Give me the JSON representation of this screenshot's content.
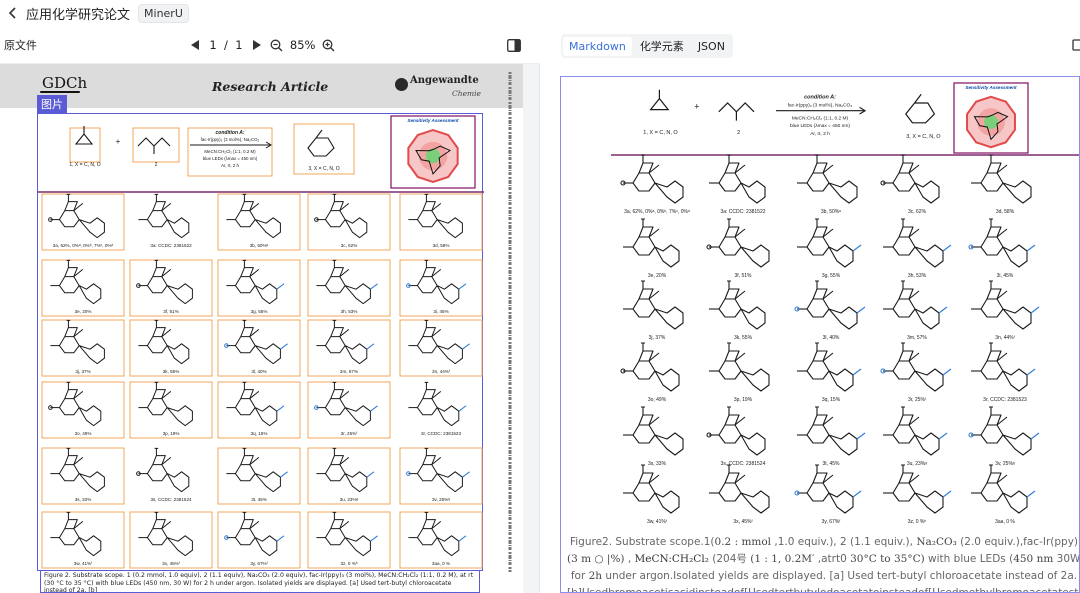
{
  "header": {
    "title": "应用化学研究论文",
    "badge": "MinerU"
  },
  "left_pane": {
    "label": "原文件",
    "current_page": "1",
    "page_separator": "/",
    "total_pages": "1",
    "zoom": "85%",
    "figure_tag": "图片",
    "page": {
      "publisher_logo": "GDCh",
      "article_type": "Research Article",
      "journal_name": "Angewandte",
      "journal_subtitle": "Chemie"
    },
    "caption_line1": "Figure 2. Substrate scope. 1 (0.2 mmol, 1.0 equiv), 2 (1.1 equiv), Na₂CO₃ (2.0 equiv), fac-Ir(ppy)₃ (3 mol%), MeCN:CH₂Cl₂ (1:1, 0.2 M), at rt",
    "caption_line2": "(30 °C to 35 °C) with blue LEDs (450 nm, 30 W) for 2 h under argon. Isolated yields are displayed. [a] Used tert-butyl chloroacetate instead of 2a. [b]"
  },
  "right_pane": {
    "tabs": [
      {
        "label": "Markdown",
        "active": true
      },
      {
        "label": "化学元素",
        "active": false
      },
      {
        "label": "JSON",
        "active": false
      }
    ],
    "caption_line1_a": "Figure2. Substrate scope.1(",
    "caption_line1_m1": "0.2  : mmol",
    "caption_line1_b": " ,1.0 equiv.), 2 (1.1 equiv.), ",
    "caption_line1_m2": "Na₂CO₃",
    "caption_line1_c": " (2.0 equiv.),fac-Ir(ppy)",
    "caption_line2_m1": "(3 m ○ |%)",
    "caption_line2_a": " , ",
    "caption_line2_b": "MeCN:CH₂Cl₂",
    "caption_line2_c": " (204号 ",
    "caption_line2_m2": "(1 : 1, 0.2M′",
    "caption_line2_d": " ,atrt0 ",
    "caption_line2_m3": "30°C to 35°C)",
    "caption_line2_e": " with blue LEDs (",
    "caption_line2_m4": "450 nm",
    "caption_line2_f": " 30W)",
    "caption_line3_a": "for ",
    "caption_line3_m1": "2h",
    "caption_line3_b": " under argon.Isolated yields are displayed. [a] Used tert-butyl chloroacetate instead of 2a.",
    "caption_line4": "[b]Usedbromoaceticacidinsteadof[Usedtertbutylodoacetateinsteadof[Usedmethylbromoacetatesteadofa eac"
  },
  "scheme": {
    "reactant1_label": "1, X = C, N, O",
    "reactant2_label": "2",
    "product_label": "3, X = C, N, O",
    "condition_title": "condition A:",
    "condition_line1": "fac-Ir(ppy)₃ (3 mol%), Na₂CO₃",
    "condition_line2": "MeCN:CH₂Cl₂ (1:1, 0.2 M)",
    "condition_line3": "blue LEDs (λmax = 450 nm)",
    "condition_line4": "Ar, rt, 2 h",
    "sensitivity_title": "Sensitivity Assessment"
  },
  "compounds_left": [
    "3a, 62%, 0%ᵃ, 0%ᵇ, 7%ᶜ, 0%ᵈ",
    "3a: CCDC: 2381522",
    "3b, 50%ᵉ",
    "3c, 62%",
    "3d, 58%",
    "3e, 20%",
    "3f, 51%",
    "3g, 55%",
    "3h, 53%",
    "3i, 45%",
    "3j, 37%",
    "3k, 55%",
    "3l, 40%",
    "3m, 57%",
    "3n, 44%ᶠ",
    "3o, 49%",
    "3p, 19%",
    "3q, 15%",
    "3r, 25%ᶠ",
    "3r, CCDC: 2381523",
    "3s, 33%",
    "3s, CCDC: 2381524",
    "3t, 45%",
    "3u, 23%ᵍ",
    "3v, 25%ᵍ",
    "3w, 41%ᶠ",
    "3x, 45%ᶠ",
    "3y, 67%ᶠ",
    "3z, 0 %ʰ",
    "3aa, 0 %"
  ],
  "compounds_right": [
    "3a, 62%, 0%ᵃ, 0%ᵇ, 7%ᶜ, 0%ᵈ",
    "3a: CCDC: 2381522",
    "3b, 50%ᵉ",
    "3c, 62%",
    "3d, 58%",
    "3e, 20%",
    "3f, 51%",
    "3g, 55%",
    "3h, 53%",
    "3i, 45%",
    "3j, 37%",
    "3k, 55%",
    "3l, 40%",
    "3m, 57%",
    "3n, 44%ᶠ",
    "3o, 49%",
    "3p, 19%",
    "3q, 15%",
    "3r, 25%ᶠ",
    "3r, CCDC: 2381523",
    "3s, 33%",
    "3s, CCDC: 2381524",
    "3t, 45%",
    "3u, 23%ᵍ",
    "3v, 25%ᵍ",
    "3w, 41%ᶠ",
    "3x, 45%ᶠ",
    "3y, 67%ᶠ",
    "3z, 0 %ʰ",
    "3aa, 0 %"
  ],
  "colors": {
    "accent": "#3b6fd9",
    "selection_frame": "#5b5bd6",
    "cell_border": "#f3a45c",
    "structure_blue": "#2f7bd6",
    "structure_black": "#1a1a1a",
    "sensitivity_red": "#e14b4b"
  },
  "icons": {
    "back": "chevron-left-icon",
    "prev_page": "triangle-left-icon",
    "next_page": "triangle-right-icon",
    "zoom_out": "zoom-out-icon",
    "zoom_in": "zoom-in-icon",
    "sidebar": "sidebar-toggle-icon",
    "copy": "copy-icon"
  }
}
